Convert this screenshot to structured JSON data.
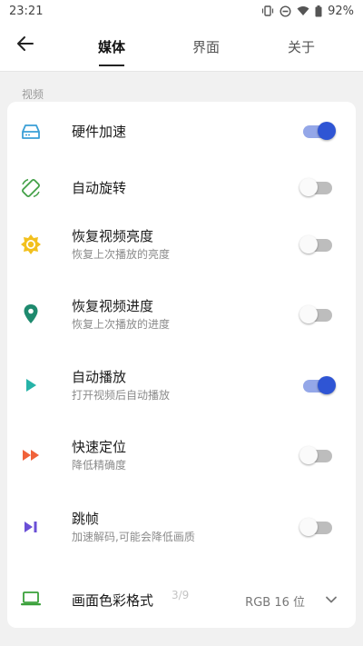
{
  "status_bar": {
    "time": "23:21",
    "battery": "92%"
  },
  "header": {
    "tabs": [
      {
        "label": "媒体",
        "active": true
      },
      {
        "label": "界面",
        "active": false
      },
      {
        "label": "关于",
        "active": false
      }
    ]
  },
  "section": {
    "label": "视频"
  },
  "settings": [
    {
      "title": "硬件加速",
      "subtitle": "",
      "toggle": true,
      "icon": "hard-drive-icon",
      "color": "#3a9fd6"
    },
    {
      "title": "自动旋转",
      "subtitle": "",
      "toggle": false,
      "icon": "screen-rotation-icon",
      "color": "#43a047"
    },
    {
      "title": "恢复视频亮度",
      "subtitle": "恢复上次播放的亮度",
      "toggle": false,
      "icon": "brightness-icon",
      "color": "#f2c01e"
    },
    {
      "title": "恢复视频进度",
      "subtitle": "恢复上次播放的进度",
      "toggle": false,
      "icon": "location-pin-icon",
      "color": "#1e8a6e"
    },
    {
      "title": "自动播放",
      "subtitle": "打开视频后自动播放",
      "toggle": true,
      "icon": "play-icon",
      "color": "#26b3a8"
    },
    {
      "title": "快速定位",
      "subtitle": "降低精确度",
      "toggle": false,
      "icon": "fast-forward-icon",
      "color": "#f0623a"
    },
    {
      "title": "跳帧",
      "subtitle": "加速解码,可能会降低画质",
      "toggle": false,
      "icon": "skip-next-icon",
      "color": "#6a4fd6"
    }
  ],
  "color_format": {
    "title": "画面色彩格式",
    "value": "RGB 16 位",
    "icon": "laptop-icon",
    "color": "#3aa03a"
  },
  "page_indicator": "3/9",
  "colors": {
    "switch_on_track": "#94a7e8",
    "switch_on_knob": "#2f55d4",
    "switch_off_track": "#bdbdbd"
  }
}
